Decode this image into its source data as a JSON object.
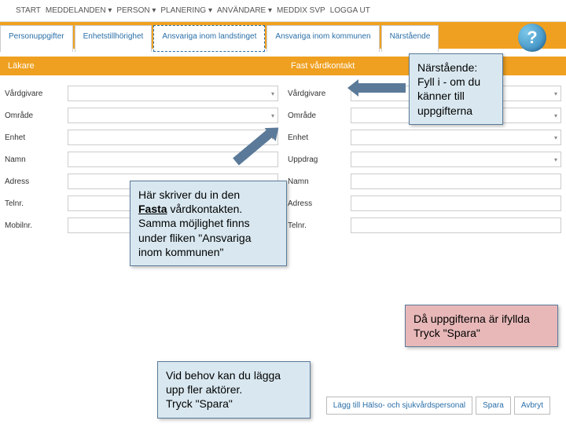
{
  "topnav": [
    "START",
    "MEDDELANDEN ▾",
    "PERSON ▾",
    "PLANERING ▾",
    "ANVÄNDARE ▾",
    "MEDDIX SVP",
    "LOGGA UT"
  ],
  "help_icon": "?",
  "tabs": [
    "Personuppgifter",
    "Enhetstillhörighet",
    "Ansvariga inom landstinget",
    "Ansvariga inom kommunen",
    "Närstående"
  ],
  "section_left": "Läkare",
  "section_right": "Fast vårdkontakt",
  "left_labels": [
    "Vårdgivare",
    "Område",
    "Enhet",
    "Namn",
    "Adress",
    "Telnr.",
    "Mobilnr."
  ],
  "right_labels": [
    "Vårdgivare",
    "Område",
    "Enhet",
    "Uppdrag",
    "Namn",
    "Adress",
    "Telnr."
  ],
  "callout1": {
    "l1": "Närstående:",
    "l2": "Fyll i - om du",
    "l3": "känner till",
    "l4": "uppgifterna"
  },
  "callout2": {
    "l1": "Här skriver du in den",
    "l2a": "Fasta",
    "l2b": " vårdkontakten.",
    "l3": "Samma möjlighet finns",
    "l4": "under fliken \"Ansvariga",
    "l5": "inom kommunen\""
  },
  "callout3": {
    "l1": "Då uppgifterna är ifyllda",
    "l2": "Tryck \"Spara\""
  },
  "callout4": {
    "l1": "Vid behov kan du lägga",
    "l2": "upp fler aktörer.",
    "l3": "Tryck \"Spara\""
  },
  "buttons": [
    "Lägg till Hälso- och sjukvårdspersonal",
    "Spara",
    "Avbryt"
  ]
}
